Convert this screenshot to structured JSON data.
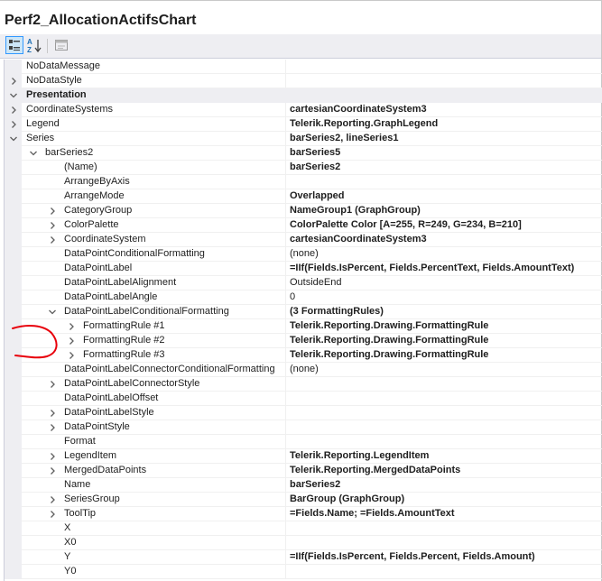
{
  "window": {
    "title": "Perf2_AllocationActifsChart"
  },
  "toolbar": {
    "categorized_icon": "categorized-view-icon",
    "alphabetical_icon": "alphabetical-sort-icon",
    "property_pages_icon": "property-pages-icon",
    "alpha_a": "A",
    "alpha_z": "Z"
  },
  "grid": {
    "rows": [
      {
        "name": "NoDataMessage",
        "value": "",
        "level": 0,
        "expander": "none",
        "bold": false,
        "category": false
      },
      {
        "name": "NoDataStyle",
        "value": "",
        "level": 0,
        "expander": "collapsed",
        "bold": false,
        "category": false
      },
      {
        "name": "Presentation",
        "value": "",
        "level": 0,
        "expander": "expanded",
        "bold": false,
        "category": true
      },
      {
        "name": "CoordinateSystems",
        "value": "cartesianCoordinateSystem3",
        "level": 0,
        "expander": "collapsed",
        "bold": true,
        "category": false
      },
      {
        "name": "Legend",
        "value": "Telerik.Reporting.GraphLegend",
        "level": 0,
        "expander": "collapsed",
        "bold": true,
        "category": false
      },
      {
        "name": "Series",
        "value": "barSeries2, lineSeries1",
        "level": 0,
        "expander": "expanded",
        "bold": true,
        "category": false
      },
      {
        "name": "barSeries2",
        "value": "barSeries5",
        "level": 1,
        "expander": "expanded",
        "bold": true,
        "category": false
      },
      {
        "name": "(Name)",
        "value": "barSeries2",
        "level": 2,
        "expander": "none",
        "bold": true,
        "category": false
      },
      {
        "name": "ArrangeByAxis",
        "value": "",
        "level": 2,
        "expander": "none",
        "bold": false,
        "category": false
      },
      {
        "name": "ArrangeMode",
        "value": "Overlapped",
        "level": 2,
        "expander": "none",
        "bold": true,
        "category": false
      },
      {
        "name": "CategoryGroup",
        "value": "NameGroup1 (GraphGroup)",
        "level": 2,
        "expander": "collapsed",
        "bold": true,
        "category": false
      },
      {
        "name": "ColorPalette",
        "value": "ColorPalette Color [A=255, R=249, G=234, B=210]",
        "level": 2,
        "expander": "collapsed",
        "bold": true,
        "category": false
      },
      {
        "name": "CoordinateSystem",
        "value": "cartesianCoordinateSystem3",
        "level": 2,
        "expander": "collapsed",
        "bold": true,
        "category": false
      },
      {
        "name": "DataPointConditionalFormatting",
        "value": "(none)",
        "level": 2,
        "expander": "none",
        "bold": false,
        "category": false
      },
      {
        "name": "DataPointLabel",
        "value": "=IIf(Fields.IsPercent, Fields.PercentText, Fields.AmountText)",
        "level": 2,
        "expander": "none",
        "bold": true,
        "category": false
      },
      {
        "name": "DataPointLabelAlignment",
        "value": "OutsideEnd",
        "level": 2,
        "expander": "none",
        "bold": false,
        "category": false
      },
      {
        "name": "DataPointLabelAngle",
        "value": "0",
        "level": 2,
        "expander": "none",
        "bold": false,
        "category": false
      },
      {
        "name": "DataPointLabelConditionalFormatting",
        "value": "(3 FormattingRules)",
        "level": 2,
        "expander": "expanded",
        "bold": true,
        "category": false
      },
      {
        "name": "FormattingRule #1",
        "value": "Telerik.Reporting.Drawing.FormattingRule",
        "level": 3,
        "expander": "collapsed",
        "bold": true,
        "category": false
      },
      {
        "name": "FormattingRule #2",
        "value": "Telerik.Reporting.Drawing.FormattingRule",
        "level": 3,
        "expander": "collapsed",
        "bold": true,
        "category": false
      },
      {
        "name": "FormattingRule #3",
        "value": "Telerik.Reporting.Drawing.FormattingRule",
        "level": 3,
        "expander": "collapsed",
        "bold": true,
        "category": false
      },
      {
        "name": "DataPointLabelConnectorConditionalFormatting",
        "value": "(none)",
        "level": 2,
        "expander": "none",
        "bold": false,
        "category": false
      },
      {
        "name": "DataPointLabelConnectorStyle",
        "value": "",
        "level": 2,
        "expander": "collapsed",
        "bold": false,
        "category": false
      },
      {
        "name": "DataPointLabelOffset",
        "value": "",
        "level": 2,
        "expander": "none",
        "bold": false,
        "category": false
      },
      {
        "name": "DataPointLabelStyle",
        "value": "",
        "level": 2,
        "expander": "collapsed",
        "bold": false,
        "category": false
      },
      {
        "name": "DataPointStyle",
        "value": "",
        "level": 2,
        "expander": "collapsed",
        "bold": false,
        "category": false
      },
      {
        "name": "Format",
        "value": "",
        "level": 2,
        "expander": "none",
        "bold": false,
        "category": false
      },
      {
        "name": "LegendItem",
        "value": "Telerik.Reporting.LegendItem",
        "level": 2,
        "expander": "collapsed",
        "bold": true,
        "category": false
      },
      {
        "name": "MergedDataPoints",
        "value": "Telerik.Reporting.MergedDataPoints",
        "level": 2,
        "expander": "collapsed",
        "bold": true,
        "category": false
      },
      {
        "name": "Name",
        "value": "barSeries2",
        "level": 2,
        "expander": "none",
        "bold": true,
        "category": false
      },
      {
        "name": "SeriesGroup",
        "value": "BarGroup (GraphGroup)",
        "level": 2,
        "expander": "collapsed",
        "bold": true,
        "category": false
      },
      {
        "name": "ToolTip",
        "value": "=Fields.Name; =Fields.AmountText",
        "level": 2,
        "expander": "collapsed",
        "bold": true,
        "category": false
      },
      {
        "name": "X",
        "value": "",
        "level": 2,
        "expander": "none",
        "bold": false,
        "category": false
      },
      {
        "name": "X0",
        "value": "",
        "level": 2,
        "expander": "none",
        "bold": false,
        "category": false
      },
      {
        "name": "Y",
        "value": "=IIf(Fields.IsPercent, Fields.Percent, Fields.Amount)",
        "level": 2,
        "expander": "none",
        "bold": true,
        "category": false
      },
      {
        "name": "Y0",
        "value": "",
        "level": 2,
        "expander": "none",
        "bold": false,
        "category": false
      }
    ]
  },
  "annotation": {
    "color": "#e8000b"
  }
}
